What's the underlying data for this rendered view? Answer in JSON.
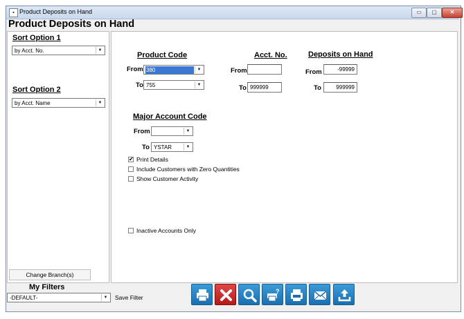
{
  "window": {
    "title": "Product Deposits on Hand",
    "icon_char": "▪"
  },
  "window_controls": {
    "minimize": "▭",
    "maximize": "▢",
    "close": "✕"
  },
  "page_title": "Product Deposits on Hand",
  "sidebar": {
    "sort1": {
      "label": "Sort Option 1",
      "value": "by Acct. No."
    },
    "sort2": {
      "label": "Sort Option 2",
      "value": "by Acct. Name"
    },
    "change_branch": "Change Branch(s)"
  },
  "product_code": {
    "heading": "Product Code",
    "from_label": "From",
    "from_value": "380",
    "to_label": "To",
    "to_value": "755"
  },
  "acct_no": {
    "heading": "Acct. No.",
    "from_label": "From",
    "from_value": "",
    "to_label": "To",
    "to_value": "999999"
  },
  "deposits": {
    "heading": "Deposits on Hand",
    "from_label": "From",
    "from_value": "-99999",
    "to_label": "To",
    "to_value": "999999"
  },
  "major_account": {
    "heading": "Major Account Code",
    "from_label": "From",
    "from_value": "",
    "to_label": "To",
    "to_value": "YSTAR"
  },
  "options": {
    "print_details": {
      "label": "Print Details",
      "checked": true
    },
    "zero_qty": {
      "label": "Include Customers with Zero Quantities",
      "checked": false
    },
    "customer_activity": {
      "label": "Show Customer Activity",
      "checked": false
    },
    "inactive_only": {
      "label": "Inactive Accounts Only",
      "checked": false
    }
  },
  "filters": {
    "label": "My Filters",
    "value": "-DEFAULT-",
    "save_label": "Save Filter"
  },
  "toolbar": [
    {
      "icon": "printer-icon",
      "color": "#2176b8"
    },
    {
      "icon": "cancel-x-icon",
      "color": "#c62828"
    },
    {
      "icon": "magnifier-icon",
      "color": "#2176b8"
    },
    {
      "icon": "print-setup-icon",
      "color": "#2176b8"
    },
    {
      "icon": "print-export-icon",
      "color": "#2176b8"
    },
    {
      "icon": "email-icon",
      "color": "#2176b8"
    },
    {
      "icon": "upload-icon",
      "color": "#2176b8"
    }
  ],
  "check_mark": "✔",
  "dropdown_arrow": "▼"
}
